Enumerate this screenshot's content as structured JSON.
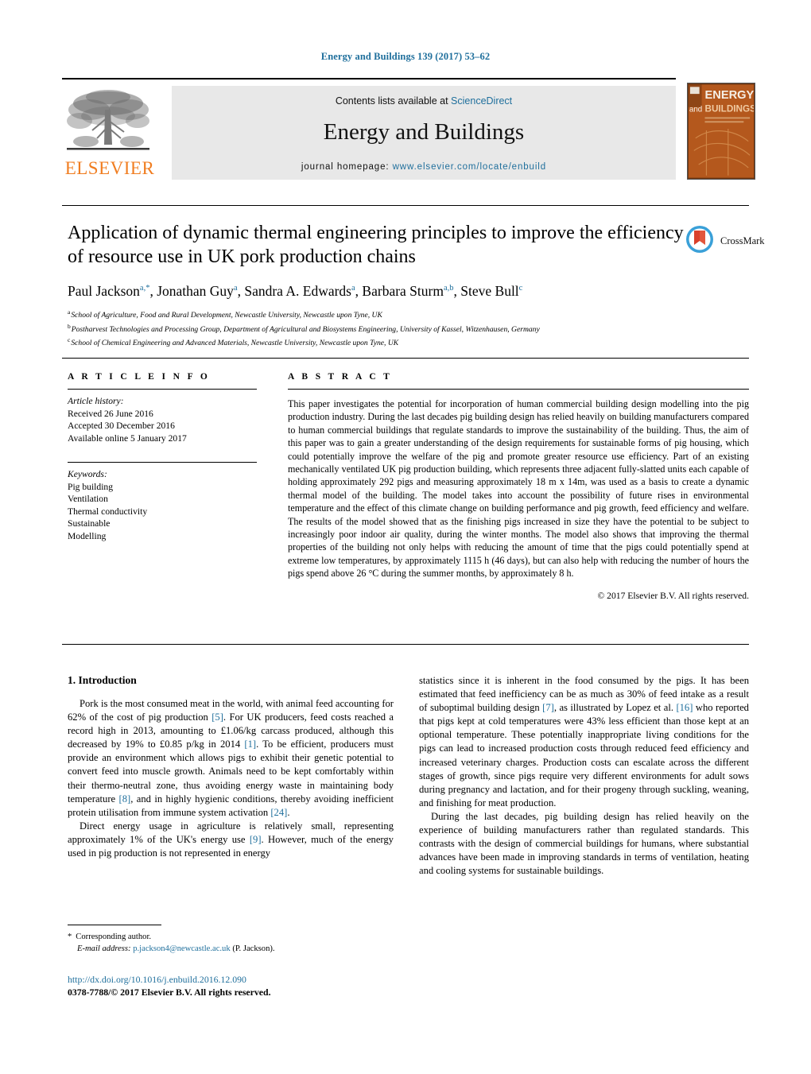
{
  "running_head": "Energy and Buildings 139 (2017) 53–62",
  "masthead": {
    "publisher_logo_text": "ELSEVIER",
    "contents_prefix": "Contents lists available at",
    "contents_link": "ScienceDirect",
    "journal_name": "Energy and Buildings",
    "homepage_prefix": "journal homepage:",
    "homepage_url": "www.elsevier.com/locate/enbuild",
    "cover": {
      "line1": "ENERGY",
      "line2": "and",
      "line3": "BUILDINGS"
    }
  },
  "article": {
    "title": "Application of dynamic thermal engineering principles to improve the efficiency of resource use in UK pork production chains",
    "authors": [
      {
        "name": "Paul Jackson",
        "marks": "a,*"
      },
      {
        "name": "Jonathan Guy",
        "marks": "a"
      },
      {
        "name": "Sandra A. Edwards",
        "marks": "a"
      },
      {
        "name": "Barbara Sturm",
        "marks": "a,b"
      },
      {
        "name": "Steve Bull",
        "marks": "c"
      }
    ],
    "affiliations": [
      {
        "label": "a",
        "text": "School of Agriculture, Food and Rural Development, Newcastle University, Newcastle upon Tyne, UK"
      },
      {
        "label": "b",
        "text": "Postharvest Technologies and Processing Group, Department of Agricultural and Biosystems Engineering, University of Kassel, Witzenhausen, Germany"
      },
      {
        "label": "c",
        "text": "School of Chemical Engineering and Advanced Materials, Newcastle University, Newcastle upon Tyne, UK"
      }
    ],
    "crossmark_label": "CrossMark"
  },
  "article_info": {
    "heading": "A R T I C L E  I N F O",
    "history_label": "Article history:",
    "history": [
      "Received 26 June 2016",
      "Accepted 30 December 2016",
      "Available online 5 January 2017"
    ],
    "keywords_label": "Keywords:",
    "keywords": [
      "Pig building",
      "Ventilation",
      "Thermal conductivity",
      "Sustainable",
      "Modelling"
    ]
  },
  "abstract": {
    "heading": "A B S T R A C T",
    "text": "This paper investigates the potential for incorporation of human commercial building design modelling into the pig production industry. During the last decades pig building design has relied heavily on building manufacturers compared to human commercial buildings that regulate standards to improve the sustainability of the building. Thus, the aim of this paper was to gain a greater understanding of the design requirements for sustainable forms of pig housing, which could potentially improve the welfare of the pig and promote greater resource use efficiency. Part of an existing mechanically ventilated UK pig production building, which represents three adjacent fully-slatted units each capable of holding approximately 292 pigs and measuring approximately 18 m x 14m, was used as a basis to create a dynamic thermal model of the building. The model takes into account the possibility of future rises in environmental temperature and the effect of this climate change on building performance and pig growth, feed efficiency and welfare. The results of the model showed that as the finishing pigs increased in size they have the potential to be subject to increasingly poor indoor air quality, during the winter months. The model also shows that improving the thermal properties of the building not only helps with reducing the amount of time that the pigs could potentially spend at extreme low temperatures, by approximately 1115 h (46 days), but can also help with reducing the number of hours the pigs spend above 26 °C during the summer months, by approximately 8 h.",
    "copyright": "© 2017 Elsevier B.V. All rights reserved."
  },
  "body": {
    "section_heading": "1.  Introduction",
    "left_paragraphs": [
      "Pork is the most consumed meat in the world, with animal feed accounting for 62% of the cost of pig production [5]. For UK producers, feed costs reached a record high in 2013, amounting to £1.06/kg carcass produced, although this decreased by 19% to £0.85 p/kg in 2014 [1]. To be efficient, producers must provide an environment which allows pigs to exhibit their genetic potential to convert feed into muscle growth. Animals need to be kept comfortably within their thermo-neutral zone, thus avoiding energy waste in maintaining body temperature [8], and in highly hygienic conditions, thereby avoiding inefficient protein utilisation from immune system activation [24].",
      "Direct energy usage in agriculture is relatively small, representing approximately 1% of the UK's energy use [9]. However, much of the energy used in pig production is not represented in energy"
    ],
    "right_paragraphs": [
      "statistics since it is inherent in the food consumed by the pigs. It has been estimated that feed inefficiency can be as much as 30% of feed intake as a result of suboptimal building design [7], as illustrated by Lopez et al. [16] who reported that pigs kept at cold temperatures were 43% less efficient than those kept at an optional temperature. These potentially inappropriate living conditions for the pigs can lead to increased production costs through reduced feed efficiency and increased veterinary charges. Production costs can escalate across the different stages of growth, since pigs require very different environments for adult sows during pregnancy and lactation, and for their progeny through suckling, weaning, and finishing for meat production.",
      "During the last decades, pig building design has relied heavily on the experience of building manufacturers rather than regulated standards. This contrasts with the design of commercial buildings for humans, where substantial advances have been made in improving standards in terms of ventilation, heating and cooling systems for sustainable buildings."
    ]
  },
  "footnote": {
    "corresponding_author": "Corresponding author.",
    "email_label": "E-mail address:",
    "email": "p.jackson4@newcastle.ac.uk",
    "email_suffix": "(P. Jackson)."
  },
  "footer": {
    "doi": "http://dx.doi.org/10.1016/j.enbuild.2016.12.090",
    "issn_line": "0378-7788/© 2017 Elsevier B.V. All rights reserved."
  },
  "colors": {
    "link": "#1f6f9c",
    "elsevier_orange": "#f07d20",
    "contents_bg": "#e8e8e8",
    "cover_bg": "#b0561c"
  }
}
